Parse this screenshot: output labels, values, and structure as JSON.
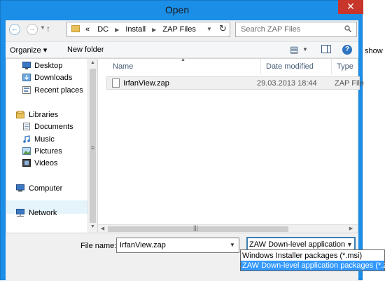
{
  "window": {
    "title": "Open",
    "close_glyph": "✕"
  },
  "background_app": {
    "text": "show in"
  },
  "address": {
    "crumbs": [
      "«",
      "DC",
      "Install",
      "ZAP Files"
    ],
    "search_placeholder": "Search ZAP Files"
  },
  "toolbar": {
    "organize_label": "Organize ▾",
    "newfolder_label": "New folder",
    "help_glyph": "?"
  },
  "nav": {
    "items": [
      {
        "label": "Desktop",
        "icon": "desktop-icon"
      },
      {
        "label": "Downloads",
        "icon": "downloads-icon"
      },
      {
        "label": "Recent places",
        "icon": "recent-places-icon"
      },
      {
        "label": "Libraries",
        "icon": "libraries-icon"
      },
      {
        "label": "Documents",
        "icon": "documents-icon"
      },
      {
        "label": "Music",
        "icon": "music-icon"
      },
      {
        "label": "Pictures",
        "icon": "pictures-icon"
      },
      {
        "label": "Videos",
        "icon": "videos-icon"
      },
      {
        "label": "Computer",
        "icon": "computer-icon"
      },
      {
        "label": "Network",
        "icon": "network-icon"
      }
    ]
  },
  "files": {
    "columns": [
      "Name",
      "Date modified",
      "Type"
    ],
    "rows": [
      {
        "name": "IrfanView.zap",
        "date": "29.03.2013 18:44",
        "type": "ZAP File"
      }
    ]
  },
  "footer": {
    "filename_label": "File name:",
    "filename_value": "IrfanView.zap",
    "filetype_value": "ZAW Down-level application packages (*.zap)",
    "filetype_options": [
      "Windows Installer packages (*.msi)",
      "ZAW Down-level application packages (*.zap)"
    ]
  },
  "colors": {
    "accent": "#1b8ee8",
    "close": "#c7352b",
    "selection": "#3399ff"
  }
}
